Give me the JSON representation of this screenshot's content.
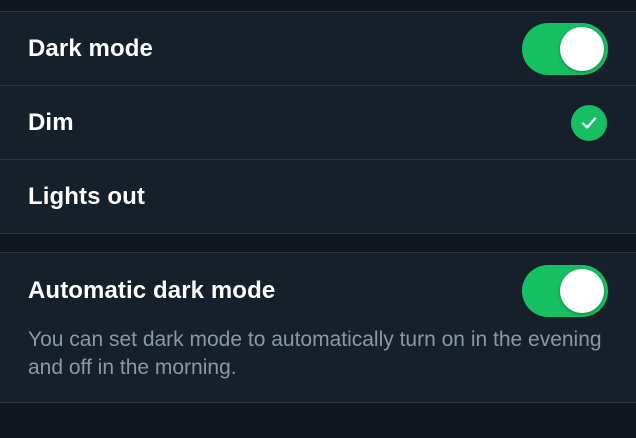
{
  "display": {
    "dark_mode": {
      "label": "Dark mode",
      "enabled": true
    },
    "themes": [
      {
        "label": "Dim",
        "selected": true
      },
      {
        "label": "Lights out",
        "selected": false
      }
    ],
    "automatic": {
      "label": "Automatic dark mode",
      "enabled": true,
      "description": "You can set dark mode to automatically turn on in the evening and off in the morning."
    }
  },
  "colors": {
    "accent": "#17bf63",
    "background": "#15202b",
    "secondary_text": "#8899a6"
  }
}
